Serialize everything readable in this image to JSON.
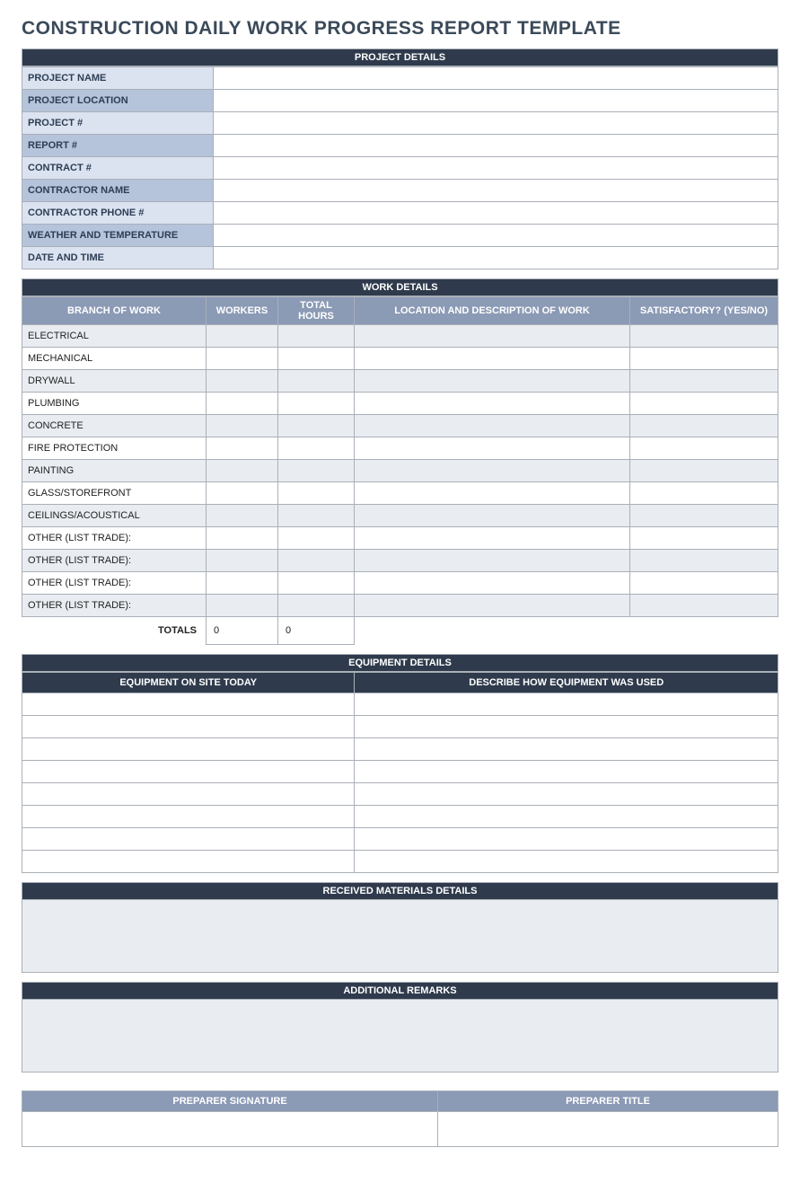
{
  "title": "CONSTRUCTION DAILY WORK PROGRESS REPORT TEMPLATE",
  "project_details": {
    "header": "PROJECT DETAILS",
    "rows": [
      {
        "label": "PROJECT NAME",
        "shade": "light",
        "value": ""
      },
      {
        "label": "PROJECT LOCATION",
        "shade": "dark",
        "value": ""
      },
      {
        "label": "PROJECT #",
        "shade": "light",
        "value": ""
      },
      {
        "label": "REPORT #",
        "shade": "dark",
        "value": ""
      },
      {
        "label": "CONTRACT #",
        "shade": "light",
        "value": ""
      },
      {
        "label": "CONTRACTOR NAME",
        "shade": "dark",
        "value": ""
      },
      {
        "label": "CONTRACTOR PHONE #",
        "shade": "light",
        "value": ""
      },
      {
        "label": "WEATHER AND TEMPERATURE",
        "shade": "dark",
        "value": ""
      },
      {
        "label": "DATE AND TIME",
        "shade": "light",
        "value": ""
      }
    ]
  },
  "work_details": {
    "header": "WORK DETAILS",
    "columns": {
      "branch": "BRANCH OF WORK",
      "workers": "WORKERS",
      "total_hours": "TOTAL HOURS",
      "location_desc": "LOCATION AND DESCRIPTION OF WORK",
      "satisfactory": "SATISFACTORY? (YES/NO)"
    },
    "rows": [
      {
        "branch": "ELECTRICAL",
        "workers": "",
        "total_hours": "",
        "location_desc": "",
        "satisfactory": ""
      },
      {
        "branch": "MECHANICAL",
        "workers": "",
        "total_hours": "",
        "location_desc": "",
        "satisfactory": ""
      },
      {
        "branch": "DRYWALL",
        "workers": "",
        "total_hours": "",
        "location_desc": "",
        "satisfactory": ""
      },
      {
        "branch": "PLUMBING",
        "workers": "",
        "total_hours": "",
        "location_desc": "",
        "satisfactory": ""
      },
      {
        "branch": "CONCRETE",
        "workers": "",
        "total_hours": "",
        "location_desc": "",
        "satisfactory": ""
      },
      {
        "branch": "FIRE PROTECTION",
        "workers": "",
        "total_hours": "",
        "location_desc": "",
        "satisfactory": ""
      },
      {
        "branch": "PAINTING",
        "workers": "",
        "total_hours": "",
        "location_desc": "",
        "satisfactory": ""
      },
      {
        "branch": "GLASS/STOREFRONT",
        "workers": "",
        "total_hours": "",
        "location_desc": "",
        "satisfactory": ""
      },
      {
        "branch": "CEILINGS/ACOUSTICAL",
        "workers": "",
        "total_hours": "",
        "location_desc": "",
        "satisfactory": ""
      },
      {
        "branch": "OTHER (LIST TRADE):",
        "workers": "",
        "total_hours": "",
        "location_desc": "",
        "satisfactory": ""
      },
      {
        "branch": "OTHER (LIST TRADE):",
        "workers": "",
        "total_hours": "",
        "location_desc": "",
        "satisfactory": ""
      },
      {
        "branch": "OTHER (LIST TRADE):",
        "workers": "",
        "total_hours": "",
        "location_desc": "",
        "satisfactory": ""
      },
      {
        "branch": "OTHER (LIST TRADE):",
        "workers": "",
        "total_hours": "",
        "location_desc": "",
        "satisfactory": ""
      }
    ],
    "totals_label": "TOTALS",
    "totals_workers": "0",
    "totals_hours": "0"
  },
  "equipment_details": {
    "header": "EQUIPMENT DETAILS",
    "columns": {
      "on_site": "EQUIPMENT ON SITE TODAY",
      "usage": "DESCRIBE HOW EQUIPMENT WAS USED"
    },
    "rows": [
      {
        "on_site": "",
        "usage": ""
      },
      {
        "on_site": "",
        "usage": ""
      },
      {
        "on_site": "",
        "usage": ""
      },
      {
        "on_site": "",
        "usage": ""
      },
      {
        "on_site": "",
        "usage": ""
      },
      {
        "on_site": "",
        "usage": ""
      },
      {
        "on_site": "",
        "usage": ""
      },
      {
        "on_site": "",
        "usage": ""
      }
    ]
  },
  "materials": {
    "header": "RECEIVED MATERIALS DETAILS",
    "content": ""
  },
  "remarks": {
    "header": "ADDITIONAL REMARKS",
    "content": ""
  },
  "signature": {
    "columns": {
      "signature": "PREPARER SIGNATURE",
      "title": "PREPARER TITLE"
    },
    "signature_value": "",
    "title_value": ""
  }
}
